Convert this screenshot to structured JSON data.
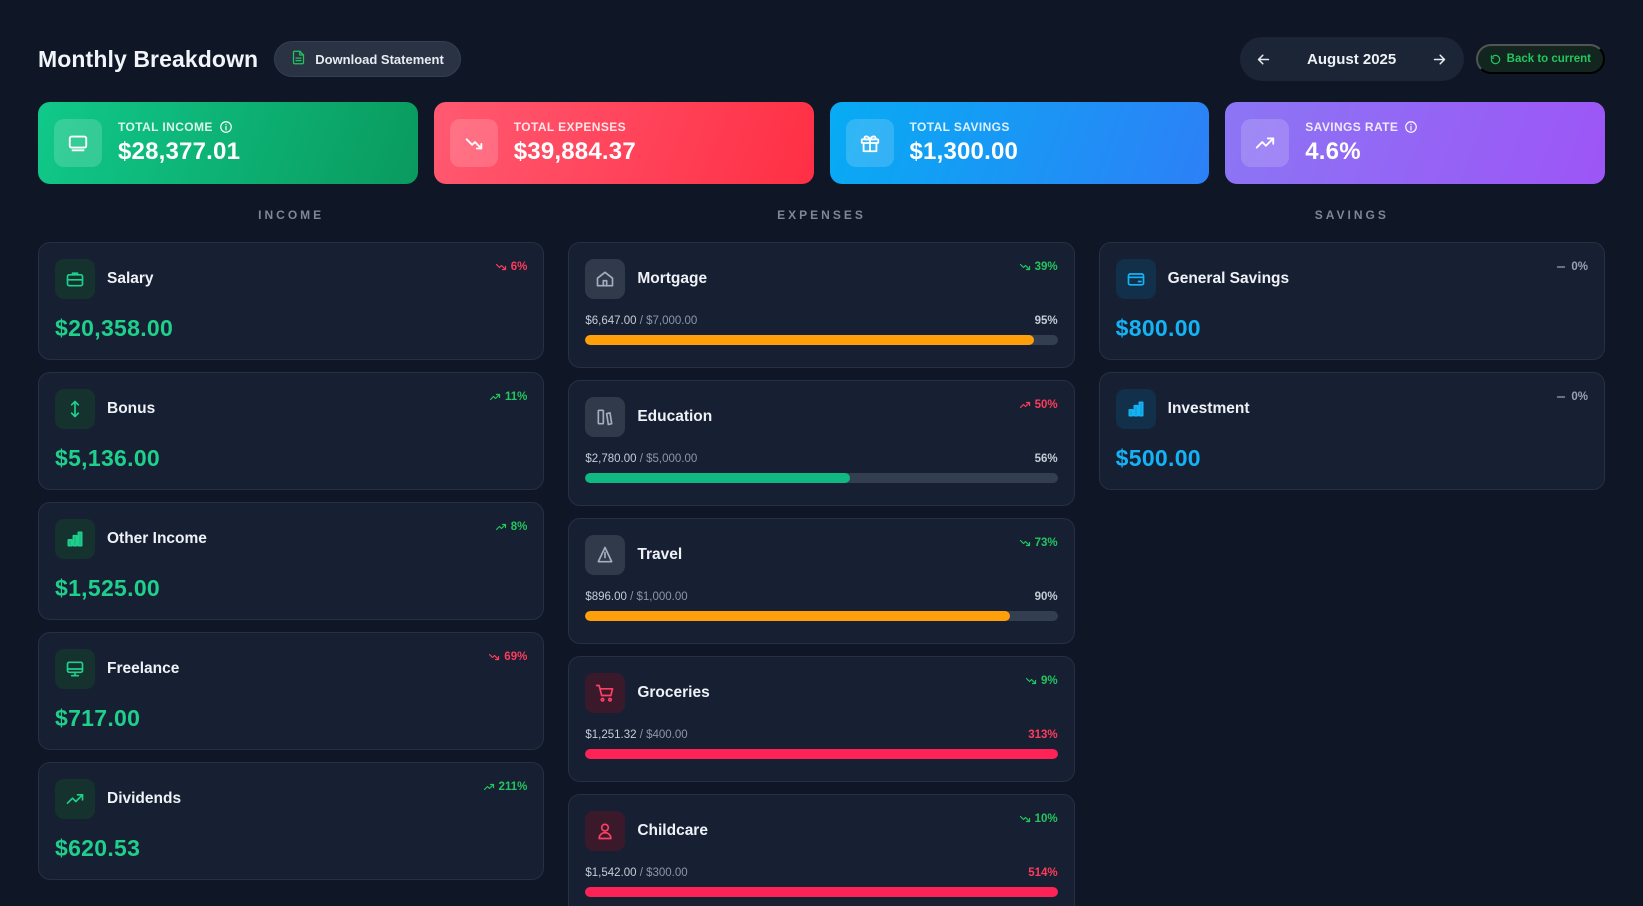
{
  "header": {
    "title": "Monthly Breakdown",
    "download_label": "Download Statement",
    "month": "August 2025",
    "back_label": "Back to current"
  },
  "summary": {
    "income": {
      "label": "TOTAL INCOME",
      "value": "$28,377.01"
    },
    "expenses": {
      "label": "TOTAL EXPENSES",
      "value": "$39,884.37"
    },
    "savings": {
      "label": "TOTAL SAVINGS",
      "value": "$1,300.00"
    },
    "rate": {
      "label": "SAVINGS RATE",
      "value": "4.6%"
    }
  },
  "columns": {
    "income_title": "INCOME",
    "expenses_title": "EXPENSES",
    "savings_title": "SAVINGS"
  },
  "income": [
    {
      "name": "Salary",
      "amount": "$20,358.00",
      "trend": "6%",
      "dir": "down",
      "icon": "briefcase-icon"
    },
    {
      "name": "Bonus",
      "amount": "$5,136.00",
      "trend": "11%",
      "dir": "up",
      "icon": "arrows-vertical-icon"
    },
    {
      "name": "Other Income",
      "amount": "$1,525.00",
      "trend": "8%",
      "dir": "up",
      "icon": "bar-chart-icon"
    },
    {
      "name": "Freelance",
      "amount": "$717.00",
      "trend": "69%",
      "dir": "down",
      "icon": "monitor-icon"
    },
    {
      "name": "Dividends",
      "amount": "$620.53",
      "trend": "211%",
      "dir": "up",
      "icon": "trending-up-icon"
    }
  ],
  "expenses": [
    {
      "name": "Mortgage",
      "spent": "$6,647.00",
      "budget": "$7,000.00",
      "pct": "95%",
      "pct_value": 95,
      "trend": "39%",
      "dir": "down-good",
      "icon": "home-icon",
      "bar": "orange"
    },
    {
      "name": "Education",
      "spent": "$2,780.00",
      "budget": "$5,000.00",
      "pct": "56%",
      "pct_value": 56,
      "trend": "50%",
      "dir": "up-bad",
      "icon": "books-icon",
      "bar": "green"
    },
    {
      "name": "Travel",
      "spent": "$896.00",
      "budget": "$1,000.00",
      "pct": "90%",
      "pct_value": 90,
      "trend": "73%",
      "dir": "down-good",
      "icon": "navigation-icon",
      "bar": "orange"
    },
    {
      "name": "Groceries",
      "spent": "$1,251.32",
      "budget": "$400.00",
      "pct": "313%",
      "pct_value": 313,
      "trend": "9%",
      "dir": "down-good",
      "icon": "cart-icon",
      "bar": "red"
    },
    {
      "name": "Childcare",
      "spent": "$1,542.00",
      "budget": "$300.00",
      "pct": "514%",
      "pct_value": 514,
      "trend": "10%",
      "dir": "down-good",
      "icon": "user-icon",
      "bar": "red"
    }
  ],
  "savings": [
    {
      "name": "General Savings",
      "amount": "$800.00",
      "trend": "0%",
      "dir": "flat",
      "icon": "wallet-icon"
    },
    {
      "name": "Investment",
      "amount": "$500.00",
      "trend": "0%",
      "dir": "flat",
      "icon": "bar-chart-icon"
    }
  ],
  "colors": {
    "background": "#0f1626",
    "card": "#172032",
    "income_green": "#1fd08d",
    "savings_blue": "#14b3f5",
    "negative_red": "#ff3b5c",
    "bar_orange": "#ff9f0a"
  }
}
